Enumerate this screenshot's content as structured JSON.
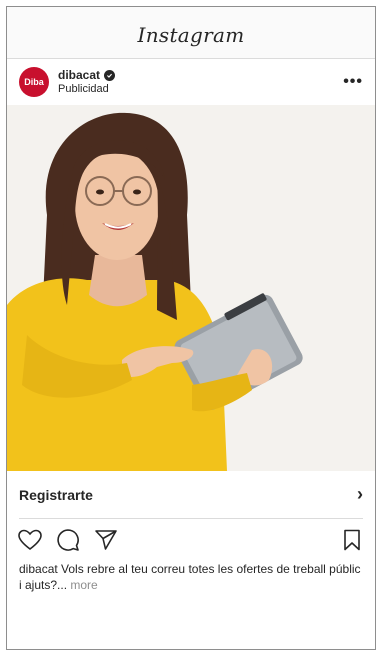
{
  "app": {
    "title": "Instagram"
  },
  "post": {
    "avatar_text": "Diba",
    "username": "dibacat",
    "sponsored": "Publicidad",
    "more_glyph": "•••",
    "image_icon": "woman-with-tablet-photo",
    "cta_label": "Registrarte",
    "cta_chevron": "›",
    "caption_user": "dibacat",
    "caption_text": " Vols rebre al teu correu totes les ofertes de treball públic i ajuts?...",
    "caption_more": " more"
  },
  "colors": {
    "brand_red": "#c8102e",
    "sweater_yellow": "#f2c21b",
    "background": "#f4f2ee"
  },
  "icons": [
    "heart-icon",
    "comment-icon",
    "share-icon",
    "bookmark-icon",
    "verified-icon"
  ]
}
